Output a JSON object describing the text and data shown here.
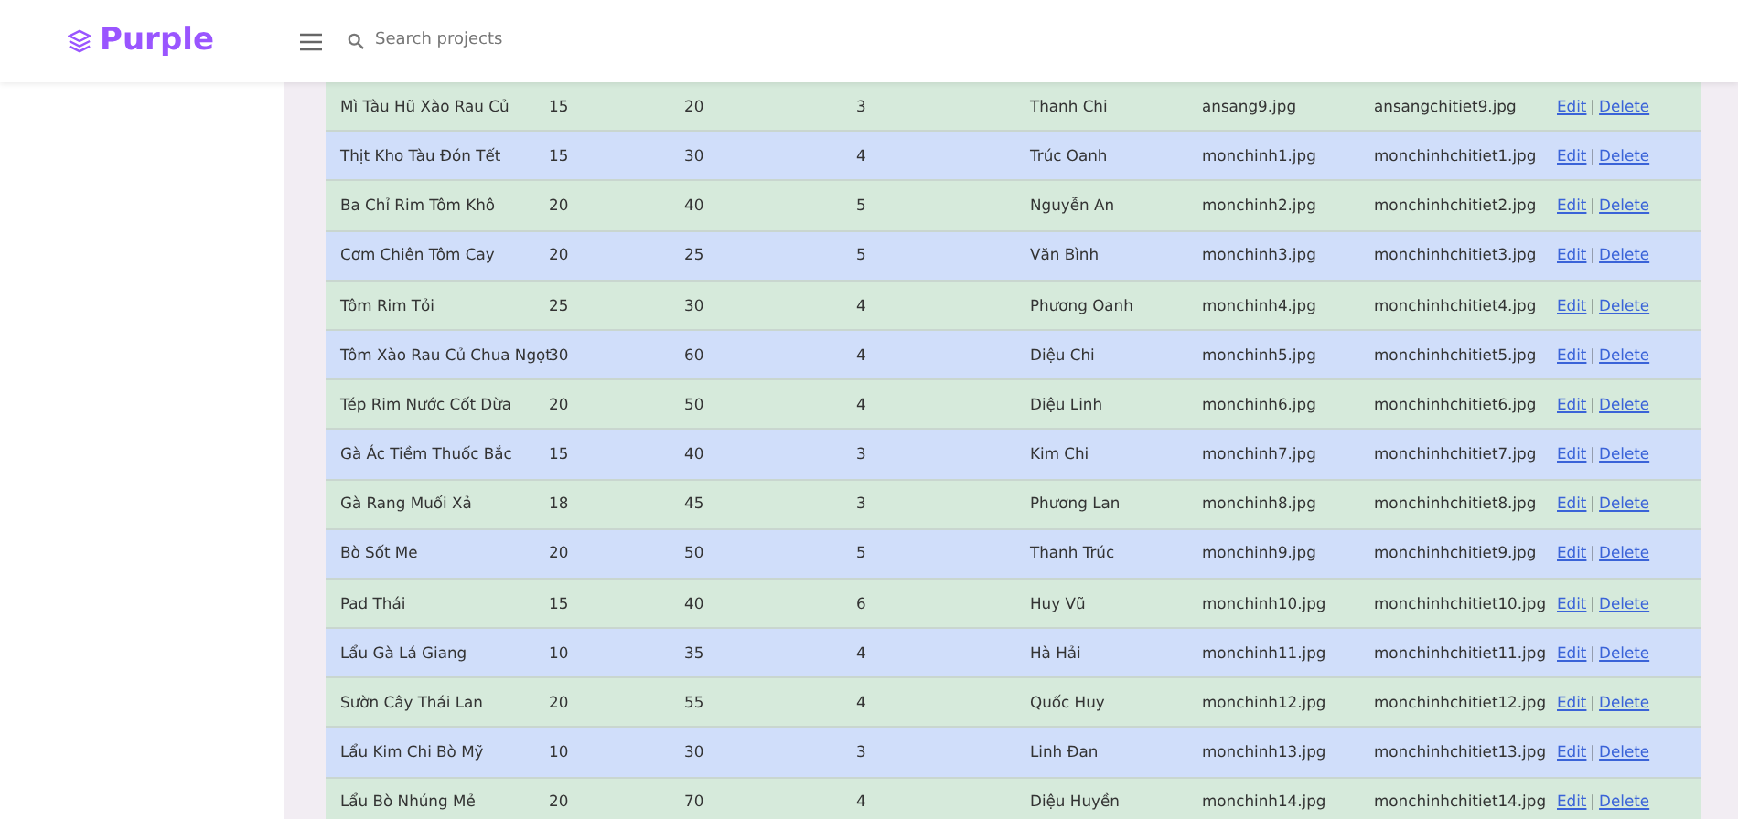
{
  "brand": {
    "name": "Purple"
  },
  "search": {
    "placeholder": "Search projects"
  },
  "rows": [
    {
      "cells": [
        "Mì Tàu Hũ Xào Rau Củ",
        "15",
        "20",
        "3",
        "Thanh Chi",
        "ansang9.jpg",
        "ansangchitiet9.jpg"
      ],
      "actions": {
        "edit": "Edit",
        "separator": "|",
        "delete": "Delete"
      }
    },
    {
      "cells": [
        "Thịt Kho Tàu Đón Tết",
        "15",
        "30",
        "4",
        "Trúc Oanh",
        "monchinh1.jpg",
        "monchinhchitiet1.jpg"
      ],
      "actions": {
        "edit": "Edit",
        "separator": "|",
        "delete": "Delete"
      }
    },
    {
      "cells": [
        "Ba Chỉ Rim Tôm Khô",
        "20",
        "40",
        "5",
        "Nguyễn An",
        "monchinh2.jpg",
        "monchinhchitiet2.jpg"
      ],
      "actions": {
        "edit": "Edit",
        "separator": "|",
        "delete": "Delete"
      }
    },
    {
      "cells": [
        "Cơm Chiên Tôm Cay",
        "20",
        "25",
        "5",
        "Văn Bình",
        "monchinh3.jpg",
        "monchinhchitiet3.jpg"
      ],
      "actions": {
        "edit": "Edit",
        "separator": "|",
        "delete": "Delete"
      }
    },
    {
      "cells": [
        "Tôm Rim Tỏi",
        "25",
        "30",
        "4",
        "Phương Oanh",
        "monchinh4.jpg",
        "monchinhchitiet4.jpg"
      ],
      "actions": {
        "edit": "Edit",
        "separator": "|",
        "delete": "Delete"
      }
    },
    {
      "cells": [
        "Tôm Xào Rau Củ Chua Ngọt",
        "30",
        "60",
        "4",
        "Diệu Chi",
        "monchinh5.jpg",
        "monchinhchitiet5.jpg"
      ],
      "actions": {
        "edit": "Edit",
        "separator": "|",
        "delete": "Delete"
      }
    },
    {
      "cells": [
        "Tép Rim Nước Cốt Dừa",
        "20",
        "50",
        "4",
        "Diệu Linh",
        "monchinh6.jpg",
        "monchinhchitiet6.jpg"
      ],
      "actions": {
        "edit": "Edit",
        "separator": "|",
        "delete": "Delete"
      }
    },
    {
      "cells": [
        "Gà Ác Tiềm Thuốc Bắc",
        "15",
        "40",
        "3",
        "Kim Chi",
        "monchinh7.jpg",
        "monchinhchitiet7.jpg"
      ],
      "actions": {
        "edit": "Edit",
        "separator": "|",
        "delete": "Delete"
      }
    },
    {
      "cells": [
        "Gà Rang Muối Xả",
        "18",
        "45",
        "3",
        "Phương Lan",
        "monchinh8.jpg",
        "monchinhchitiet8.jpg"
      ],
      "actions": {
        "edit": "Edit",
        "separator": "|",
        "delete": "Delete"
      }
    },
    {
      "cells": [
        "Bò Sốt Me",
        "20",
        "50",
        "5",
        "Thanh Trúc",
        "monchinh9.jpg",
        "monchinhchitiet9.jpg"
      ],
      "actions": {
        "edit": "Edit",
        "separator": "|",
        "delete": "Delete"
      }
    },
    {
      "cells": [
        "Pad Thái",
        "15",
        "40",
        "6",
        "Huy Vũ",
        "monchinh10.jpg",
        "monchinhchitiet10.jpg"
      ],
      "actions": {
        "edit": "Edit",
        "separator": "|",
        "delete": "Delete"
      }
    },
    {
      "cells": [
        "Lẩu Gà Lá Giang",
        "10",
        "35",
        "4",
        "Hà Hải",
        "monchinh11.jpg",
        "monchinhchitiet11.jpg"
      ],
      "actions": {
        "edit": "Edit",
        "separator": "|",
        "delete": "Delete"
      }
    },
    {
      "cells": [
        "Sườn Cây Thái Lan",
        "20",
        "55",
        "4",
        "Quốc Huy",
        "monchinh12.jpg",
        "monchinhchitiet12.jpg"
      ],
      "actions": {
        "edit": "Edit",
        "separator": "|",
        "delete": "Delete"
      }
    },
    {
      "cells": [
        "Lẩu Kim Chi Bò Mỹ",
        "10",
        "30",
        "3",
        "Linh Đan",
        "monchinh13.jpg",
        "monchinhchitiet13.jpg"
      ],
      "actions": {
        "edit": "Edit",
        "separator": "|",
        "delete": "Delete"
      }
    },
    {
      "cells": [
        "Lẩu Bò Nhúng Mẻ",
        "20",
        "70",
        "4",
        "Diệu Huyền",
        "monchinh14.jpg",
        "monchinhchitiet14.jpg"
      ],
      "actions": {
        "edit": "Edit",
        "separator": "|",
        "delete": "Delete"
      }
    }
  ]
}
